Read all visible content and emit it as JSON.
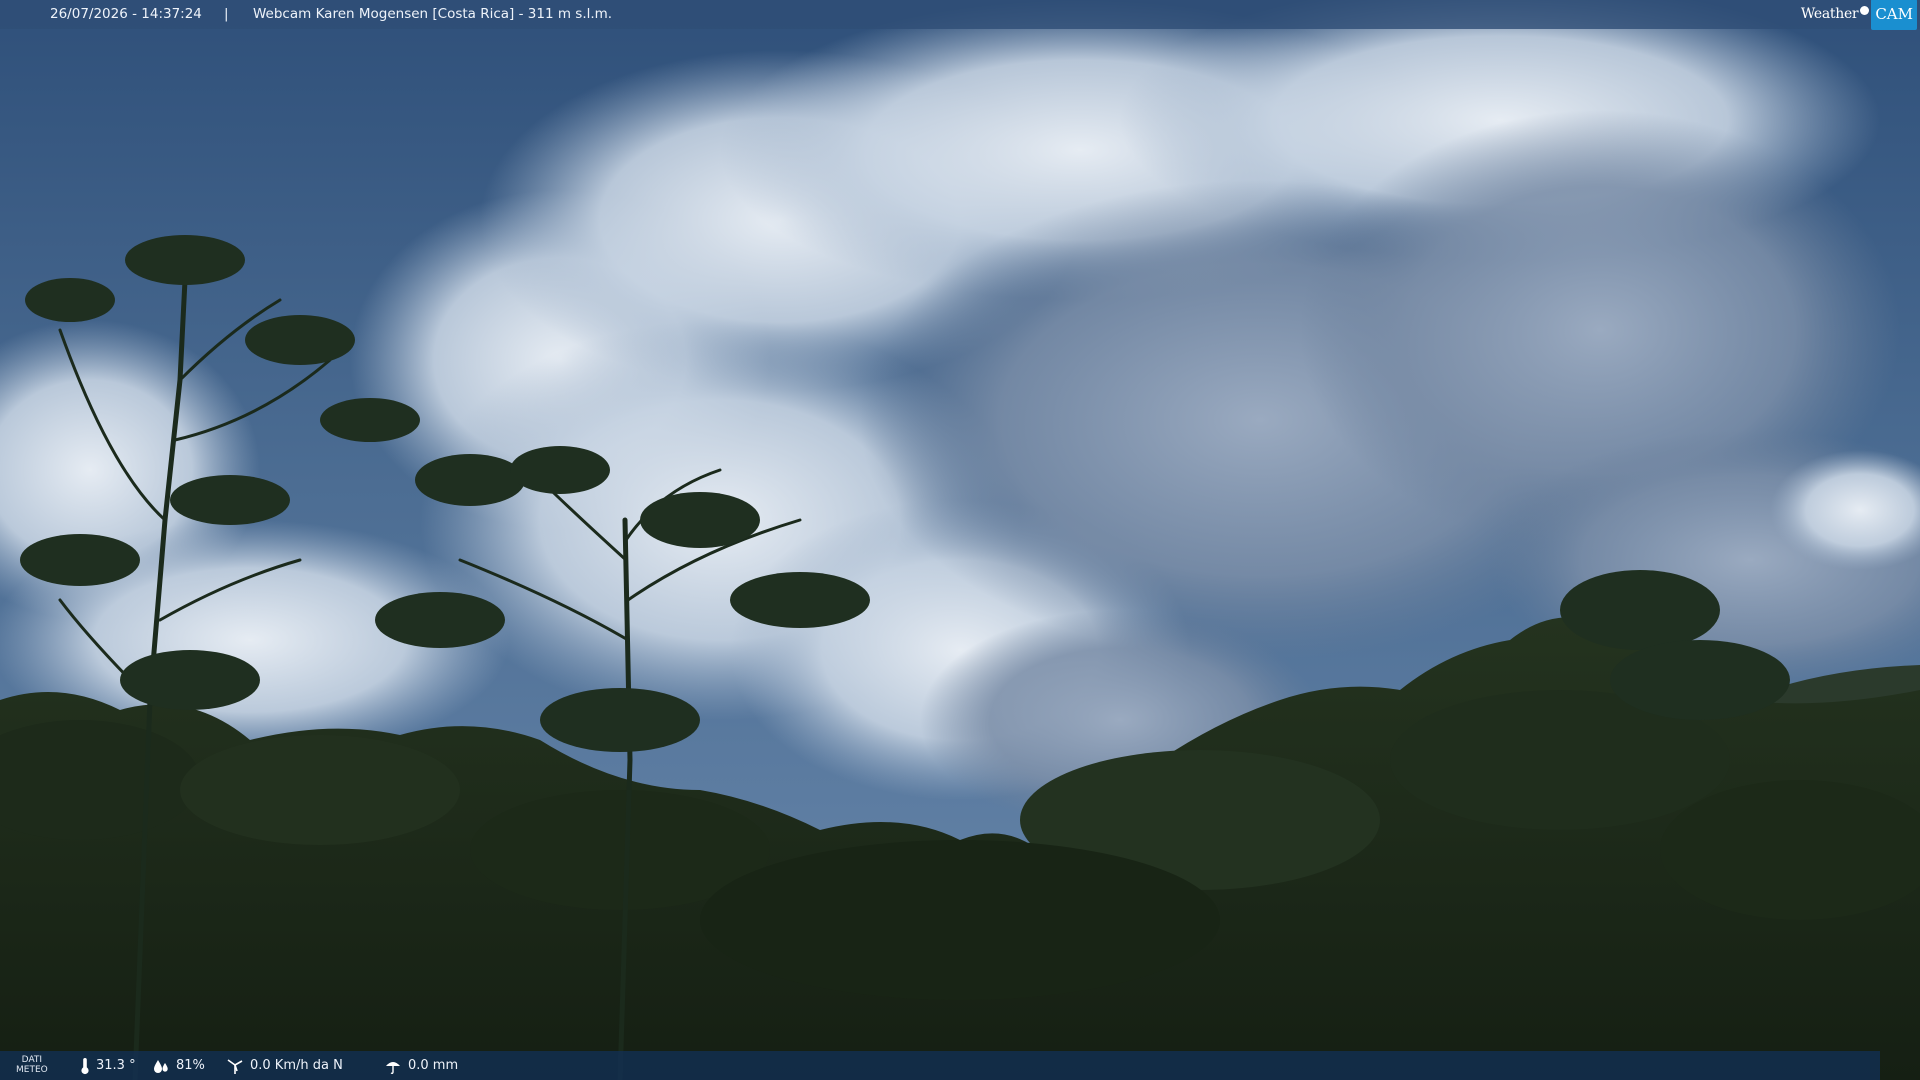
{
  "overlay": {
    "timestamp": "26/07/2026 - 14:37:24",
    "separator": "|",
    "title": "Webcam Karen Mogensen [Costa Rica]  - 311 m s.l.m.",
    "brand_weather": "Weather",
    "brand_cam": "CAM"
  },
  "meteo": {
    "label_line1": "DATI",
    "label_line2": "METEO",
    "temperature": "31.3 °",
    "humidity": "81%",
    "wind": "0.0 Km/h da N",
    "rain": "0.0 mm"
  },
  "icons": {
    "temperature": "thermometer-icon",
    "humidity": "droplets-icon",
    "wind": "wind-turbine-icon",
    "rain": "umbrella-icon"
  },
  "colors": {
    "top_bar": "#304e76",
    "bottom_bar": "#123054",
    "brand_accent": "#1a8fd0"
  }
}
